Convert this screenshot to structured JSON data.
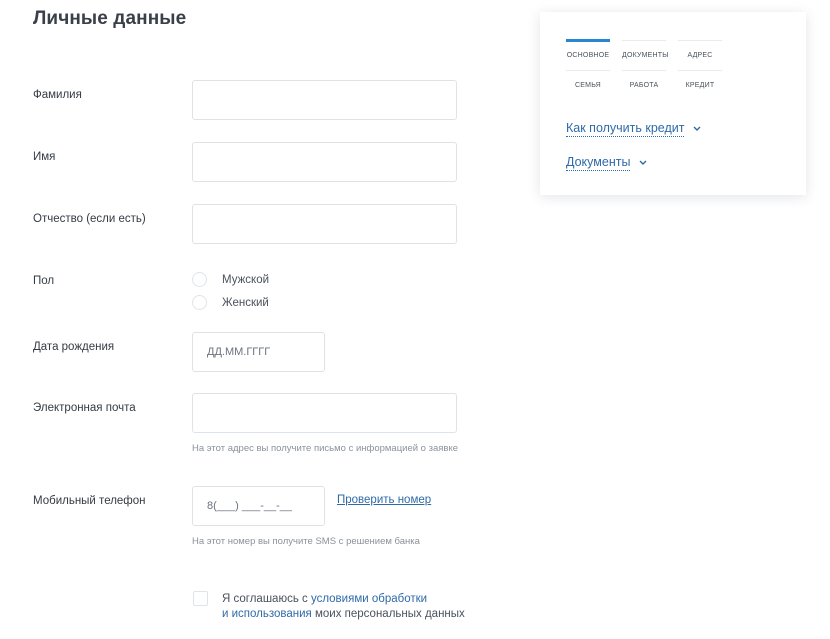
{
  "page": {
    "title": "Личные данные"
  },
  "form": {
    "surname_label": "Фамилия",
    "name_label": "Имя",
    "patronymic_label": "Отчество (если есть)",
    "gender_label": "Пол",
    "gender_options": [
      "Мужской",
      "Женский"
    ],
    "birthdate_label": "Дата рождения",
    "birthdate_placeholder": "ДД.ММ.ГГГГ",
    "email_label": "Электронная почта",
    "email_hint": "На этот адрес вы получите письмо с информацией о заявке",
    "phone_label": "Мобильный телефон",
    "phone_placeholder": "8(___) ___-__-__",
    "check_number_label": "Проверить номер",
    "phone_hint": "На этот номер вы получите SMS с решением банка",
    "consent_prefix": "Я соглашаюсь с ",
    "consent_link_line1": "условиями обработки",
    "consent_link_line2": "и использования",
    "consent_suffix": " моих персональных данных"
  },
  "sidebar": {
    "tabs": [
      {
        "label": "ОСНОВНОЕ",
        "active": true
      },
      {
        "label": "ДОКУМЕНТЫ",
        "active": false
      },
      {
        "label": "АДРЕС",
        "active": false
      },
      {
        "label": "СЕМЬЯ",
        "active": false
      },
      {
        "label": "РАБОТА",
        "active": false
      },
      {
        "label": "КРЕДИТ",
        "active": false
      }
    ],
    "links": [
      {
        "label": "Как получить кредит",
        "icon": "chevron-down-icon"
      },
      {
        "label": "Документы",
        "icon": "chevron-down-icon"
      }
    ]
  },
  "colors": {
    "accent": "#2a85d0",
    "link": "#2f6aa8",
    "border": "#dfe3e8"
  }
}
